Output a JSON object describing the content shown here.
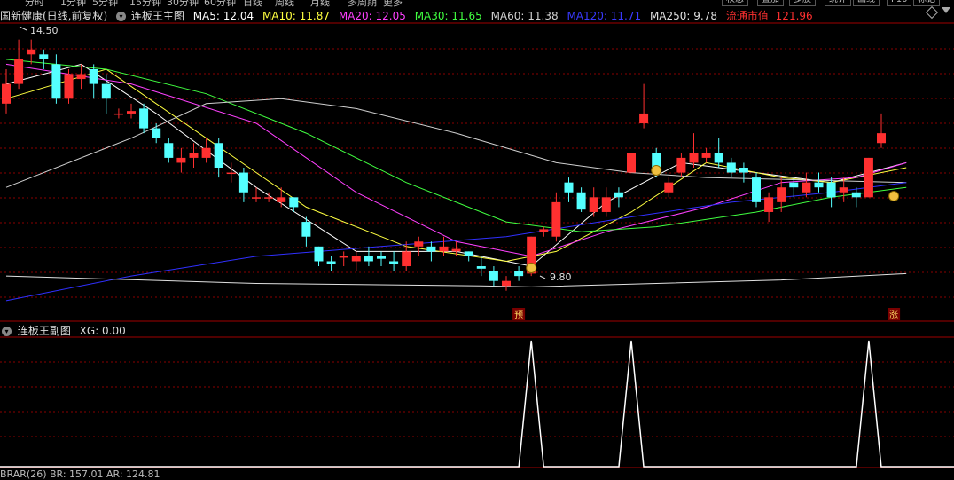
{
  "colors": {
    "up": "#ff3030",
    "down": "#54ffff",
    "ma5": "#ffffff",
    "ma10": "#ffff40",
    "ma20": "#ff40ff",
    "ma30": "#40ff40",
    "ma60": "#d0d0d0",
    "ma120": "#3030ff",
    "ma250": "#e0e0e0",
    "grid": "#8a0000",
    "border": "#a00000",
    "float_cap": "#ff3030"
  },
  "topbar": {
    "tabs": [
      "分时",
      "1分钟",
      "5分钟",
      "15分钟",
      "30分钟",
      "60分钟",
      "日线",
      "周线",
      "月线",
      "多周期",
      "更多"
    ],
    "right_buttons": [
      "权息",
      "叠加",
      "多股",
      "统计",
      "画线",
      "F10",
      "标记"
    ]
  },
  "main": {
    "stock_name": "国新健康(日线,前复权)",
    "indicator_name": "连板王主图",
    "ma": [
      {
        "label": "MA5: 12.04"
      },
      {
        "label": "MA10: 11.87"
      },
      {
        "label": "MA20: 12.05"
      },
      {
        "label": "MA30: 11.65"
      },
      {
        "label": "MA60: 11.38"
      },
      {
        "label": "MA120: 11.71"
      },
      {
        "label": "MA250: 9.78"
      }
    ],
    "float_cap_label": "流通市值",
    "float_cap_value": "121.96",
    "high_label": "14.50",
    "low_label": "9.80",
    "markers": [
      {
        "text": "预"
      },
      {
        "text": "涨"
      }
    ],
    "diamond_icon": "diamond-icon"
  },
  "sub": {
    "indicator_name": "连板王副图",
    "xg_label": "XG: 0.00"
  },
  "bottom": {
    "text": "BRAR(26)  BR: 157.01  AR: 124.81"
  },
  "chart_data": {
    "type": "candlestick",
    "price_range": [
      9.0,
      14.8
    ],
    "candles": [
      [
        13.2,
        13.6,
        13.9,
        13.0
      ],
      [
        13.6,
        14.1,
        14.5,
        13.5
      ],
      [
        14.2,
        14.3,
        14.5,
        14.0
      ],
      [
        14.2,
        14.1,
        14.3,
        13.9
      ],
      [
        14.0,
        13.3,
        14.2,
        13.2
      ],
      [
        13.3,
        13.8,
        13.9,
        13.2
      ],
      [
        13.7,
        13.8,
        14.0,
        13.5
      ],
      [
        13.9,
        13.6,
        14.0,
        13.3
      ],
      [
        13.6,
        13.3,
        13.8,
        13.0
      ],
      [
        13.0,
        13.0,
        13.1,
        12.9
      ],
      [
        13.0,
        13.05,
        13.2,
        12.9
      ],
      [
        13.1,
        12.7,
        13.2,
        12.6
      ],
      [
        12.7,
        12.5,
        12.8,
        12.4
      ],
      [
        12.4,
        12.1,
        12.5,
        12.0
      ],
      [
        12.0,
        12.1,
        12.3,
        11.8
      ],
      [
        12.1,
        12.2,
        12.4,
        11.9
      ],
      [
        12.1,
        12.3,
        12.5,
        12.0
      ],
      [
        12.4,
        11.9,
        12.5,
        11.7
      ],
      [
        11.8,
        11.8,
        12.0,
        11.6
      ],
      [
        11.8,
        11.4,
        11.9,
        11.2
      ],
      [
        11.3,
        11.3,
        11.5,
        11.2
      ],
      [
        11.3,
        11.3,
        11.4,
        11.2
      ],
      [
        11.2,
        11.3,
        11.5,
        11.1
      ],
      [
        11.3,
        11.1,
        11.3,
        11.0
      ],
      [
        10.8,
        10.5,
        10.9,
        10.3
      ],
      [
        10.3,
        10.0,
        10.3,
        9.9
      ],
      [
        10.0,
        9.95,
        10.1,
        9.8
      ],
      [
        10.1,
        10.1,
        10.2,
        9.9
      ],
      [
        10.0,
        10.1,
        10.2,
        9.8
      ],
      [
        10.1,
        10.0,
        10.3,
        9.9
      ],
      [
        10.1,
        10.05,
        10.2,
        9.9
      ],
      [
        10.0,
        9.95,
        10.2,
        9.8
      ],
      [
        9.9,
        10.2,
        10.4,
        9.8
      ],
      [
        10.3,
        10.4,
        10.5,
        10.1
      ],
      [
        10.3,
        10.2,
        10.4,
        10.0
      ],
      [
        10.2,
        10.3,
        10.5,
        10.1
      ],
      [
        10.2,
        10.25,
        10.4,
        10.1
      ],
      [
        10.2,
        10.1,
        10.2,
        10.0
      ],
      [
        9.9,
        9.85,
        10.1,
        9.7
      ],
      [
        9.8,
        9.6,
        9.9,
        9.5
      ],
      [
        9.5,
        9.6,
        9.7,
        9.4
      ],
      [
        9.8,
        9.7,
        9.9,
        9.6
      ],
      [
        9.75,
        10.5,
        10.5,
        9.7
      ],
      [
        10.6,
        10.65,
        10.7,
        10.5
      ],
      [
        10.5,
        11.2,
        11.4,
        10.4
      ],
      [
        11.6,
        11.4,
        11.7,
        11.2
      ],
      [
        11.4,
        11.05,
        11.5,
        11.0
      ],
      [
        11.0,
        11.3,
        11.5,
        10.9
      ],
      [
        11.0,
        11.3,
        11.5,
        10.9
      ],
      [
        11.4,
        11.3,
        11.5,
        11.1
      ],
      [
        11.8,
        12.2,
        12.2,
        11.8
      ],
      [
        12.8,
        13.0,
        13.6,
        12.7
      ],
      [
        12.2,
        11.8,
        12.3,
        11.7
      ],
      [
        11.4,
        11.6,
        11.7,
        11.3
      ],
      [
        11.8,
        12.1,
        12.2,
        11.7
      ],
      [
        12.0,
        12.2,
        12.6,
        11.9
      ],
      [
        12.1,
        12.2,
        12.3,
        12.0
      ],
      [
        12.2,
        12.0,
        12.5,
        11.9
      ],
      [
        12.0,
        11.8,
        12.1,
        11.7
      ],
      [
        11.9,
        11.8,
        12.0,
        11.6
      ],
      [
        11.7,
        11.2,
        11.8,
        11.1
      ],
      [
        11.0,
        11.3,
        11.4,
        10.8
      ],
      [
        11.2,
        11.5,
        11.7,
        11.0
      ],
      [
        11.6,
        11.5,
        11.7,
        11.3
      ],
      [
        11.4,
        11.6,
        11.8,
        11.3
      ],
      [
        11.6,
        11.5,
        11.8,
        11.4
      ],
      [
        11.6,
        11.3,
        11.7,
        11.1
      ],
      [
        11.4,
        11.5,
        11.7,
        11.2
      ],
      [
        11.4,
        11.3,
        11.5,
        11.1
      ],
      [
        11.3,
        12.1,
        12.1,
        11.3
      ],
      [
        12.4,
        12.6,
        13.0,
        12.3
      ]
    ],
    "ma_series": {
      "ma5": [
        [
          0,
          13.6
        ],
        [
          6,
          14.0
        ],
        [
          12,
          13.0
        ],
        [
          20,
          11.5
        ],
        [
          28,
          10.2
        ],
        [
          36,
          10.2
        ],
        [
          42,
          9.9
        ],
        [
          48,
          11.2
        ],
        [
          54,
          12.0
        ],
        [
          60,
          11.8
        ],
        [
          66,
          11.6
        ],
        [
          72,
          12.0
        ]
      ],
      "ma10": [
        [
          0,
          13.3
        ],
        [
          8,
          13.9
        ],
        [
          16,
          12.5
        ],
        [
          24,
          11.1
        ],
        [
          32,
          10.3
        ],
        [
          40,
          10.0
        ],
        [
          44,
          10.2
        ],
        [
          50,
          11.0
        ],
        [
          56,
          12.0
        ],
        [
          62,
          11.7
        ],
        [
          66,
          11.6
        ],
        [
          72,
          11.9
        ]
      ],
      "ma20": [
        [
          0,
          14.0
        ],
        [
          10,
          13.6
        ],
        [
          20,
          12.8
        ],
        [
          28,
          11.4
        ],
        [
          36,
          10.4
        ],
        [
          42,
          10.1
        ],
        [
          48,
          10.6
        ],
        [
          56,
          11.1
        ],
        [
          62,
          11.6
        ],
        [
          68,
          11.7
        ],
        [
          72,
          12.0
        ]
      ],
      "ma30": [
        [
          0,
          14.1
        ],
        [
          8,
          13.9
        ],
        [
          16,
          13.4
        ],
        [
          24,
          12.6
        ],
        [
          32,
          11.6
        ],
        [
          40,
          10.8
        ],
        [
          46,
          10.6
        ],
        [
          52,
          10.7
        ],
        [
          60,
          11.0
        ],
        [
          66,
          11.3
        ],
        [
          72,
          11.5
        ]
      ],
      "ma60": [
        [
          0,
          11.5
        ],
        [
          10,
          12.5
        ],
        [
          16,
          13.2
        ],
        [
          22,
          13.3
        ],
        [
          28,
          13.1
        ],
        [
          36,
          12.6
        ],
        [
          44,
          12.0
        ],
        [
          50,
          11.8
        ],
        [
          56,
          11.7
        ],
        [
          64,
          11.65
        ],
        [
          72,
          11.6
        ]
      ],
      "ma120": [
        [
          0,
          9.2
        ],
        [
          10,
          9.7
        ],
        [
          20,
          10.1
        ],
        [
          30,
          10.3
        ],
        [
          40,
          10.5
        ],
        [
          50,
          10.9
        ],
        [
          58,
          11.2
        ],
        [
          66,
          11.4
        ],
        [
          72,
          11.6
        ]
      ],
      "ma250": [
        [
          0,
          9.7
        ],
        [
          20,
          9.55
        ],
        [
          38,
          9.5
        ],
        [
          42,
          9.48
        ],
        [
          52,
          9.55
        ],
        [
          62,
          9.62
        ],
        [
          72,
          9.75
        ]
      ]
    },
    "xg_signal": [
      {
        "x": 42,
        "value": 1
      },
      {
        "x": 50,
        "value": 1
      },
      {
        "x": 69,
        "value": 1
      }
    ]
  }
}
